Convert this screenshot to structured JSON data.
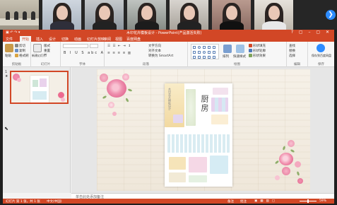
{
  "meeting": {
    "participants": [
      {
        "name": "",
        "type": "room"
      },
      {
        "name": "",
        "type": "person"
      },
      {
        "name": "",
        "type": "person"
      },
      {
        "name": "",
        "type": "person"
      },
      {
        "name": "",
        "type": "person"
      },
      {
        "name": "",
        "type": "person"
      },
      {
        "name": "",
        "type": "person"
      }
    ],
    "next_icon": "chevron-right-icon"
  },
  "ppt": {
    "window_title": "木印花卉模板设计 - PowerPoint(产品激活失败)",
    "quick_access": "▣ ↶ ↷ ▾",
    "window_controls": "? ▢ – ▢ ✕",
    "file_tab": "文件",
    "tabs": [
      "开始",
      "插入",
      "设计",
      "切换",
      "动画",
      "幻灯片放映",
      "审阅",
      "视图",
      "百度网盘"
    ],
    "active_tab_index": 0,
    "ribbon": {
      "clipboard": {
        "name": "剪贴板",
        "paste": "粘贴",
        "cut": "剪切",
        "copy": "复制",
        "format_painter": "格式刷"
      },
      "slides": {
        "name": "幻灯片",
        "new_slide": "新建幻灯片",
        "layout": "版式",
        "reset": "重置",
        "section": "节"
      },
      "font": {
        "name": "字体",
        "format_buttons": "B I U S abc A"
      },
      "paragraph": {
        "name": "段落",
        "text_direction": "文字方向",
        "align_text": "对齐文本",
        "smartart": "转换为 SmartArt"
      },
      "drawing": {
        "name": "绘图",
        "arrange": "排列",
        "quick_styles": "快速样式",
        "shape_fill": "形状填充",
        "shape_outline": "形状轮廓",
        "shape_effects": "形状效果"
      },
      "editing": {
        "name": "编辑",
        "find": "查找",
        "replace": "替换",
        "select": "选择"
      },
      "save": {
        "name": "保存",
        "save_to_cloud": "保存到百度网盘"
      }
    },
    "slide_panel": {
      "slide_number": "1",
      "star": "★"
    },
    "slide": {
      "card_title": "厨房",
      "card_subtitle": "木印花卉模板设计"
    },
    "notes_placeholder": "单击此处添加备注",
    "status": {
      "slide_info": "幻灯片 第 1 张，共 1 张",
      "language": "中文(中国)",
      "notes": "备注",
      "comments": "批注",
      "zoom": "59%"
    }
  },
  "colors": {
    "accent": "#d24726",
    "zoom_blue": "#2d8cff"
  }
}
